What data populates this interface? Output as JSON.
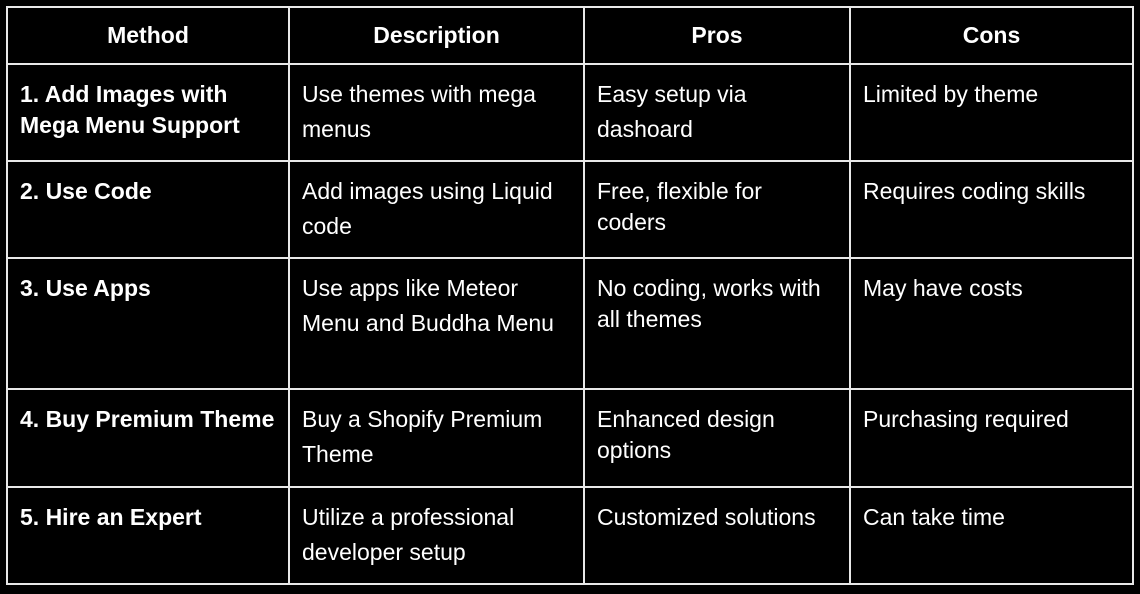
{
  "headers": [
    "Method",
    "Description",
    "Pros",
    "Cons"
  ],
  "rows": [
    {
      "method": "1. Add Images with Mega Menu Support",
      "description": "Use themes with mega menus",
      "pros": "Easy setup via dashoard",
      "cons": "Limited by theme"
    },
    {
      "method": "2. Use Code",
      "description": "Add images using Liquid code",
      "pros": "Free, flexible for coders",
      "cons": "Requires coding skills"
    },
    {
      "method": "3. Use Apps",
      "description": "Use apps like Meteor Menu and Buddha Menu",
      "pros": "No coding, works with all themes",
      "cons": "May have costs"
    },
    {
      "method": "4. Buy Premium Theme",
      "description": "Buy a Shopify Premium Theme",
      "pros": "Enhanced design options",
      "cons": "Purchasing required"
    },
    {
      "method": "5. Hire an Expert",
      "description": "Utilize a professional developer setup",
      "pros": "Customized solutions",
      "cons": "Can take time"
    }
  ]
}
